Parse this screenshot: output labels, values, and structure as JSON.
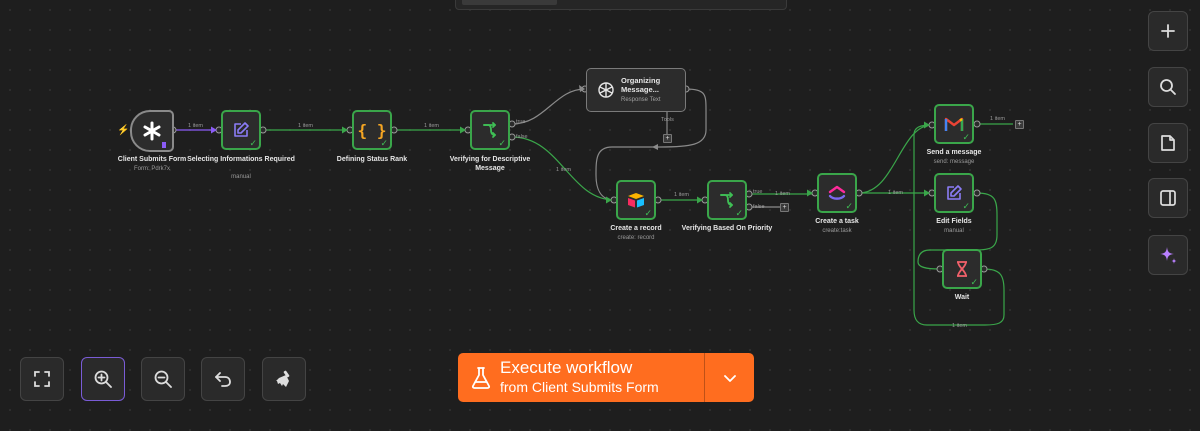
{
  "nodes": {
    "trigger": {
      "title": "Client Submits Form",
      "subtitle": "Form: Pdrk7x",
      "icon": "asterisk-icon"
    },
    "set1": {
      "title": "Selecting Informations Required",
      "subtitle": "manual",
      "icon": "pencil-square-icon"
    },
    "code": {
      "title": "Defining Status Rank",
      "icon": "braces-icon"
    },
    "if1": {
      "title": "Verifying for Descriptive Message",
      "icon": "branch-icon"
    },
    "ai": {
      "title": "Organizing Message...",
      "subtitle": "Response Text",
      "icon": "openai-icon"
    },
    "airtable": {
      "title": "Create a record",
      "subtitle": "create: record",
      "icon": "airtable-icon"
    },
    "if2": {
      "title": "Verifying Based On Priority",
      "icon": "branch-icon"
    },
    "clickup": {
      "title": "Create a task",
      "subtitle": "create:task",
      "icon": "clickup-icon"
    },
    "gmail": {
      "title": "Send a message",
      "subtitle": "send: message",
      "icon": "gmail-icon"
    },
    "edit": {
      "title": "Edit Fields",
      "subtitle": "manual",
      "icon": "pencil-square-icon"
    },
    "wait": {
      "title": "Wait",
      "icon": "hourglass-icon"
    }
  },
  "edge_labels": {
    "e1": "1 item",
    "e2": "1 item",
    "e3": "1 item",
    "e4": "1 item",
    "e5": "1 item",
    "e6": "1 item",
    "e7": "1 item",
    "e8": "1 item",
    "loop": "1 item",
    "true1": "true",
    "false1": "false",
    "true2": "true",
    "false2": "false",
    "tools": "Tools"
  },
  "right_toolbar": [
    "plus-icon",
    "search-icon",
    "sticky-note-icon",
    "panel-icon",
    "sparkle-icon"
  ],
  "bottom_toolbar": [
    "zoom-to-fit-icon",
    "zoom-in-icon",
    "zoom-out-icon",
    "undo-icon",
    "clear-execution-icon"
  ],
  "execute": {
    "title": "Execute workflow",
    "subtitle": "from Client Submits Form"
  },
  "colors": {
    "success": "#3aa64a",
    "accent": "#ff6d1f",
    "purple": "#7a5cd6",
    "canvas": "#1e1e1e"
  }
}
